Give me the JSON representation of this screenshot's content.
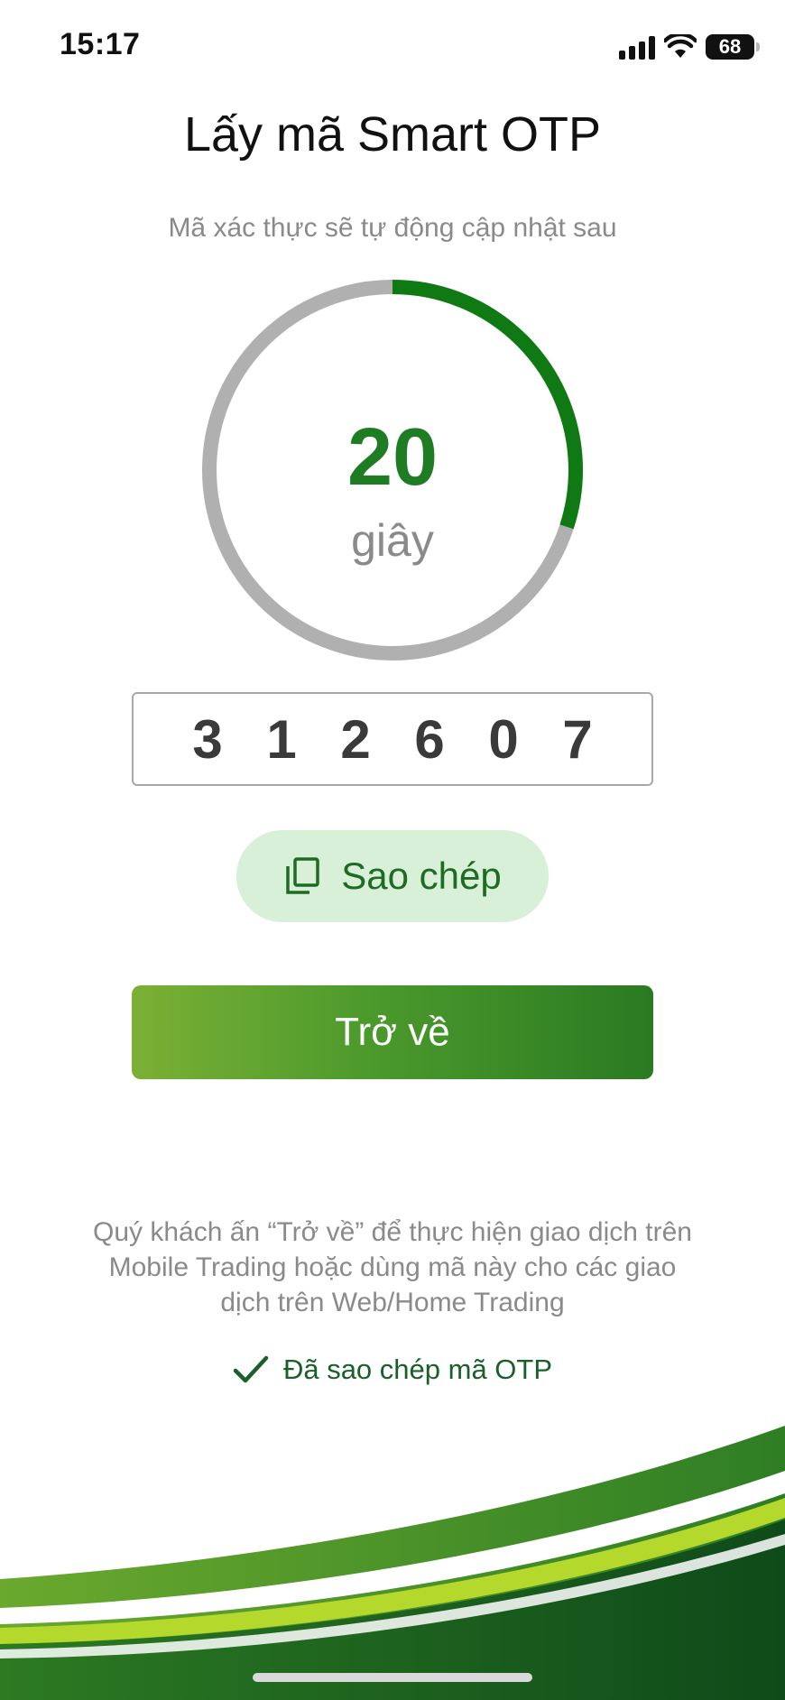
{
  "status_bar": {
    "time": "15:17",
    "battery_level": "68",
    "icons": [
      "signal-icon",
      "wifi-icon",
      "battery-icon"
    ]
  },
  "page": {
    "title": "Lấy mã Smart OTP",
    "subtitle": "Mã xác thực sẽ tự động cập nhật sau"
  },
  "countdown": {
    "seconds": "20",
    "unit": "giây",
    "progress_fraction": 0.3,
    "progress_color": "#0f7a14",
    "track_color": "#b0b0b0"
  },
  "otp": {
    "digits": [
      "3",
      "1",
      "2",
      "6",
      "0",
      "7"
    ]
  },
  "actions": {
    "copy_label": "Sao chép",
    "copy_icon": "copy-icon",
    "back_label": "Trở về"
  },
  "info": {
    "text": "Quý khách ấn “Trở về” để thực hiện giao dịch trên Mobile Trading hoặc dùng mã này cho các giao dịch trên Web/Home Trading",
    "copied_status": "Đã sao chép mã OTP",
    "copied_icon": "check-icon"
  },
  "colors": {
    "brand_green": "#1e7d22",
    "button_gradient_start": "#7bb035",
    "button_gradient_end": "#2a7a22",
    "copy_button_bg": "#d8efd8"
  }
}
